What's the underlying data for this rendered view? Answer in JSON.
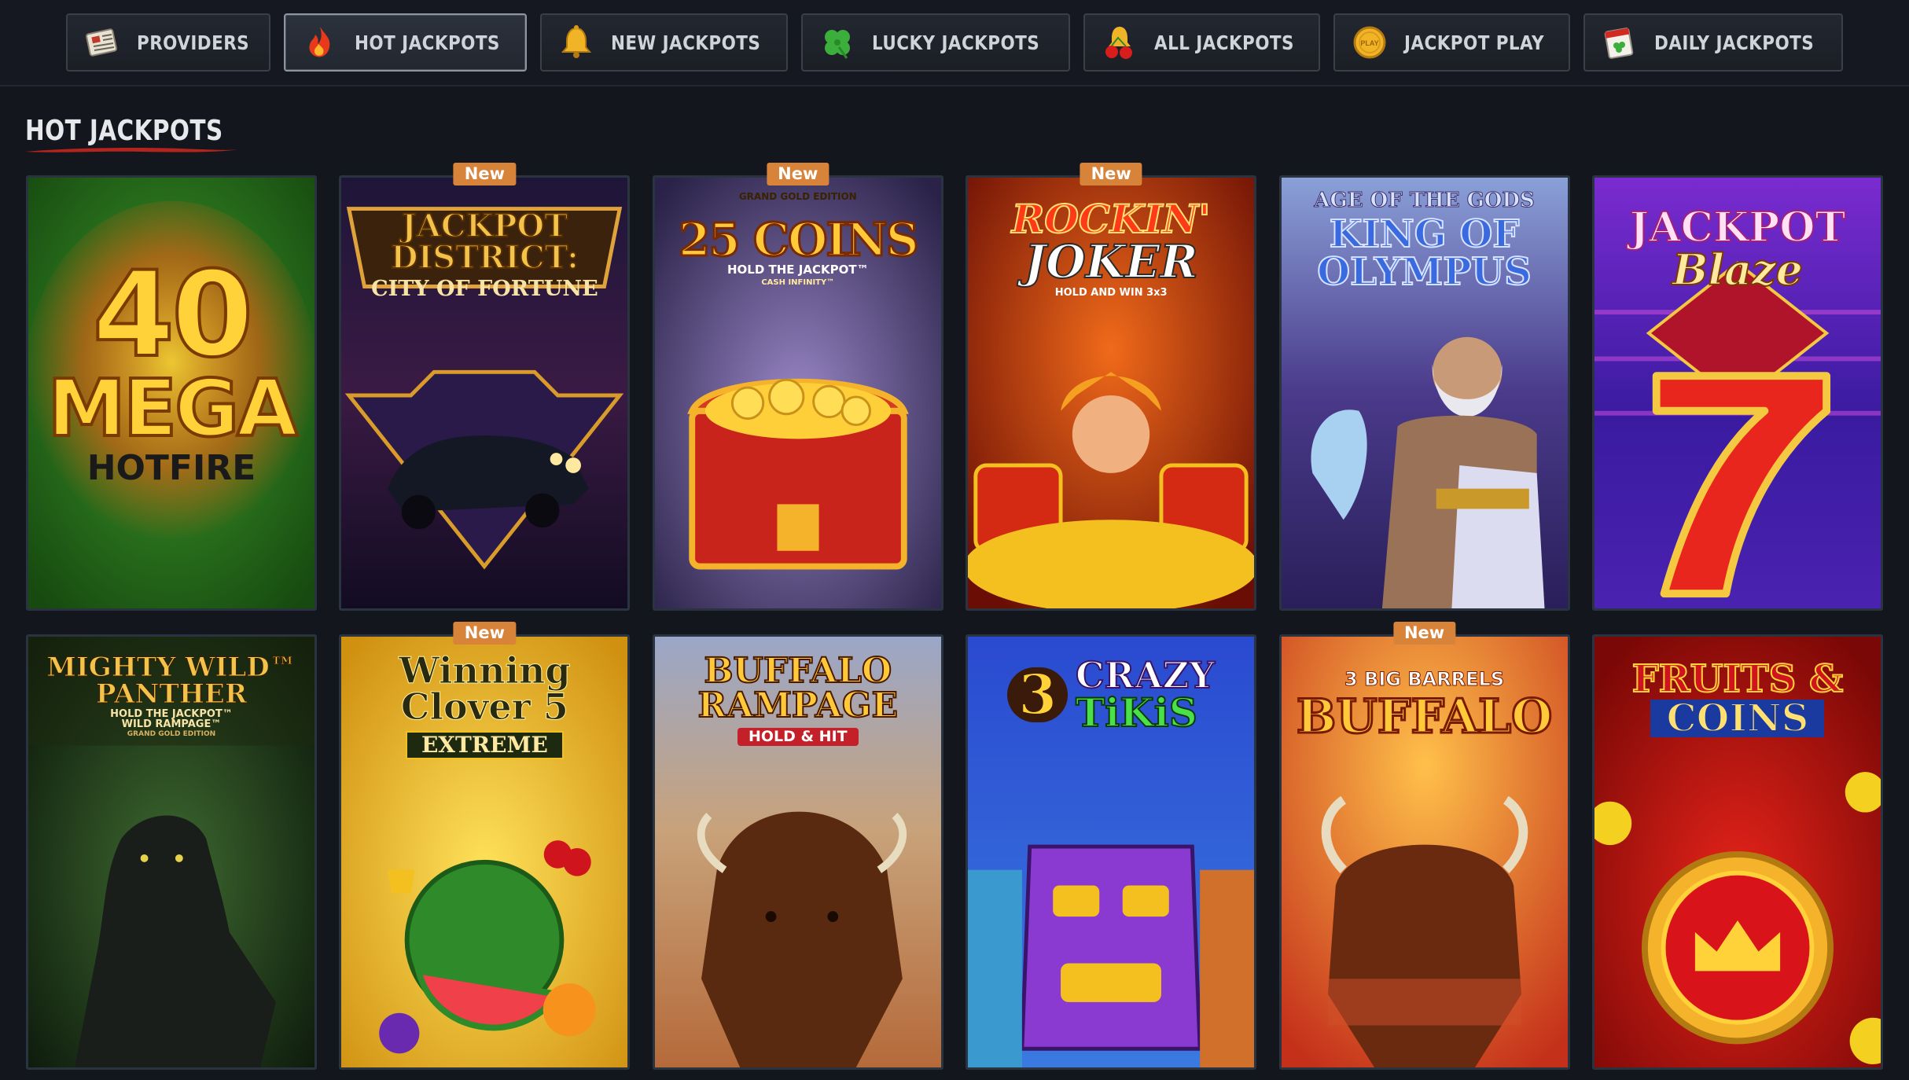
{
  "nav": {
    "tabs": [
      {
        "label": "PROVIDERS",
        "icon": "newspaper-icon",
        "active": false
      },
      {
        "label": "HOT JACKPOTS",
        "icon": "flame-icon",
        "active": true
      },
      {
        "label": "NEW JACKPOTS",
        "icon": "bell-icon",
        "active": false
      },
      {
        "label": "LUCKY JACKPOTS",
        "icon": "clover-icon",
        "active": false
      },
      {
        "label": "ALL JACKPOTS",
        "icon": "cherries-bell-icon",
        "active": false
      },
      {
        "label": "JACKPOT PLAY",
        "icon": "play-coin-icon",
        "active": false
      },
      {
        "label": "DAILY JACKPOTS",
        "icon": "calendar-clover-icon",
        "active": false
      }
    ]
  },
  "section": {
    "title": "HOT JACKPOTS"
  },
  "games": [
    {
      "title_lines": [
        "40",
        "MEGA",
        "HOTFIRE"
      ],
      "badge": "",
      "colors": [
        "#2f7a22",
        "#1d5214"
      ]
    },
    {
      "title_lines": [
        "JACKPOT",
        "DISTRICT:",
        "CITY OF FORTUNE"
      ],
      "badge": "New",
      "colors": [
        "#2a1f4a",
        "#150f2a"
      ]
    },
    {
      "title_lines": [
        "GRAND GOLD EDITION",
        "25 COINS",
        "HOLD THE JACKPOT™",
        "CASH INFINITY™"
      ],
      "badge": "New",
      "colors": [
        "#6a5a8e",
        "#2b2446"
      ]
    },
    {
      "title_lines": [
        "ROCKIN'",
        "JOKER",
        "HOLD AND WIN 3x3"
      ],
      "badge": "New",
      "colors": [
        "#c22a10",
        "#5e0d05"
      ]
    },
    {
      "title_lines": [
        "AGE OF THE GODS",
        "KING OF",
        "OLYMPUS"
      ],
      "badge": "",
      "colors": [
        "#7d8fc4",
        "#3a2e6a"
      ]
    },
    {
      "title_lines": [
        "JACKPOT",
        "Blaze"
      ],
      "badge": "",
      "colors": [
        "#6f2bc2",
        "#3a1a8a"
      ]
    },
    {
      "title_lines": [
        "MIGHTY WILD™",
        "PANTHER",
        "HOLD THE JACKPOT™",
        "WILD RAMPAGE™",
        "GRAND GOLD EDITION"
      ],
      "badge": "",
      "colors": [
        "#24441f",
        "#0f1d0e"
      ]
    },
    {
      "title_lines": [
        "Winning",
        "Clover 5",
        "EXTREME"
      ],
      "badge": "New",
      "colors": [
        "#f0c52d",
        "#c88a10"
      ]
    },
    {
      "title_lines": [
        "BUFFALO",
        "RAMPAGE",
        "HOLD & HIT"
      ],
      "badge": "",
      "colors": [
        "#9aa7c8",
        "#b26536"
      ]
    },
    {
      "title_lines": [
        "3",
        "CRAZY",
        "TiKiS"
      ],
      "badge": "",
      "colors": [
        "#2c5ed8",
        "#1a2f8e"
      ]
    },
    {
      "title_lines": [
        "3 BIG BARRELS",
        "BUFFALO"
      ],
      "badge": "New",
      "colors": [
        "#f07a1e",
        "#b62d10"
      ]
    },
    {
      "title_lines": [
        "FRUITS &",
        "COINS"
      ],
      "badge": "",
      "colors": [
        "#d81d14",
        "#8a0a08"
      ]
    }
  ]
}
